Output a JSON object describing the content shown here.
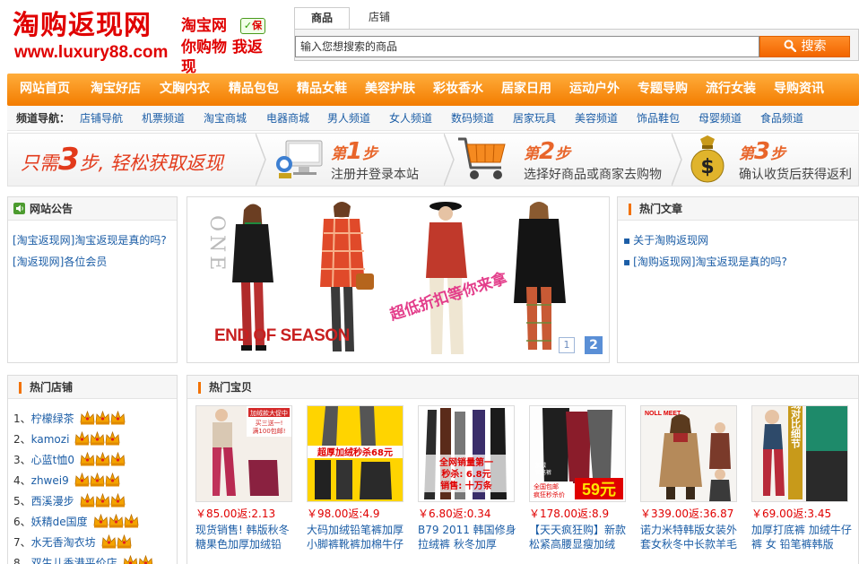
{
  "logo": {
    "main": "淘购返现网",
    "url": "www.luxury88.com",
    "side_line1": "淘宝网",
    "side_line2": "你购物 我返现",
    "badge": "保"
  },
  "search": {
    "tabs": [
      "商品",
      "店铺"
    ],
    "active_tab": "商品",
    "placeholder": "输入您想搜索的商品",
    "button": "搜索"
  },
  "main_nav": [
    "网站首页",
    "淘宝好店",
    "文胸内衣",
    "精品包包",
    "精品女鞋",
    "美容护肤",
    "彩妆香水",
    "居家日用",
    "运动户外",
    "专题导购",
    "流行女装",
    "导购资讯"
  ],
  "sub_nav": {
    "label": "频道导航：",
    "items": [
      "店铺导航",
      "机票频道",
      "淘宝商城",
      "电器商城",
      "男人频道",
      "女人频道",
      "数码频道",
      "居家玩具",
      "美容频道",
      "饰品鞋包",
      "母婴频道",
      "食品频道"
    ]
  },
  "steps": {
    "intro_pre": "只需",
    "intro_num": "3",
    "intro_post": "步, 轻松获取返现",
    "items": [
      {
        "pre": "第",
        "num": "1",
        "post": "步",
        "desc": "注册并登录本站"
      },
      {
        "pre": "第",
        "num": "2",
        "post": "步",
        "desc": "选择好商品或商家去购物"
      },
      {
        "pre": "第",
        "num": "3",
        "post": "步",
        "desc": "确认收货后获得返利"
      }
    ]
  },
  "notice": {
    "title": "网站公告",
    "items": [
      "[淘宝返现网]淘宝返现是真的吗?",
      "[淘返现网]各位会员"
    ]
  },
  "banner": {
    "vertical_text": "ONE",
    "eos_text": "END OF SEASON",
    "slogan": "超低折扣等你来拿",
    "pages": [
      "1",
      "2"
    ],
    "active_page": "2"
  },
  "hot_articles": {
    "title": "热门文章",
    "items": [
      "关于淘购返现网",
      "[淘购返现网]淘宝返现是真的吗?"
    ]
  },
  "hot_shops": {
    "title": "热门店铺",
    "items": [
      {
        "num": "1、",
        "name": "柠檬绿茶",
        "crowns": 3
      },
      {
        "num": "2、",
        "name": "kamozi",
        "crowns": 3
      },
      {
        "num": "3、",
        "name": "心蓝t恤0",
        "crowns": 3
      },
      {
        "num": "4、",
        "name": "zhwei9",
        "crowns": 3
      },
      {
        "num": "5、",
        "name": "西溪漫步",
        "crowns": 3
      },
      {
        "num": "6、",
        "name": "妖精de国度",
        "crowns": 3
      },
      {
        "num": "7、",
        "name": "水无香淘衣坊",
        "crowns": 2
      },
      {
        "num": "8、",
        "name": "双生儿香港平价店",
        "crowns": 2
      }
    ]
  },
  "hot_items": {
    "title": "热门宝贝",
    "products": [
      {
        "price": "￥85.00返:2.13",
        "name": "现货销售! 韩版秋冬糖果色加厚加绒铅",
        "img_text": [
          "加绒款大促中",
          "买三送一!",
          "满100包邮!"
        ]
      },
      {
        "price": "￥98.00返:4.9",
        "name": "大码加绒铅笔裤加厚小脚裤靴裤加棉牛仔",
        "img_text": [
          "超厚加绒秒杀68元"
        ]
      },
      {
        "price": "￥6.80返:0.34",
        "name": "B79 2011 韩国修身拉绒裤 秋冬加厚",
        "img_text": [
          "全网销量第一",
          "秒杀: 6.8元",
          "销售: 十万条"
        ]
      },
      {
        "price": "￥178.00返:8.9",
        "name": "【天天疯狂购】新款松紧高腰显瘦加绒",
        "img_text": [
          "加绒",
          "铅笔裤",
          "全国包邮",
          "疯狂秒杀价",
          "59元"
        ]
      },
      {
        "price": "￥339.00返:36.87",
        "name": "诺力米特韩版女装外套女秋冬中长款羊毛",
        "img_text": [
          "NOLL MEET"
        ]
      },
      {
        "price": "￥69.00返:3.45",
        "name": "加厚打底裤 加绒牛仔裤 女 铅笔裤韩版",
        "img_text": [
          "加绒对比细节"
        ]
      }
    ]
  },
  "colors": {
    "brand_red": "#e00000",
    "nav_orange": "#f37c00",
    "link_blue": "#1b5da6",
    "price_red": "#e00000"
  }
}
